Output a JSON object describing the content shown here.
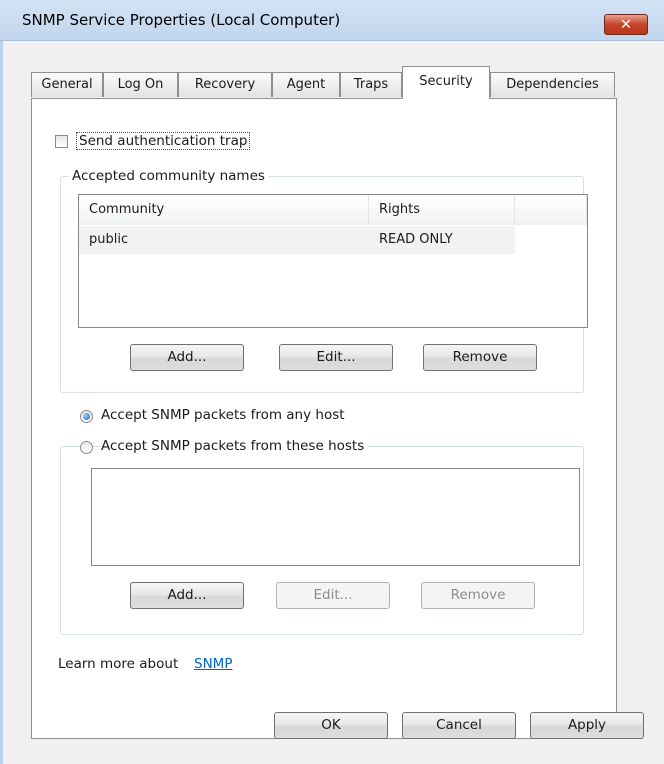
{
  "window": {
    "title": "SNMP Service Properties (Local Computer)",
    "close_label": "✕"
  },
  "tabs": [
    {
      "label": "General"
    },
    {
      "label": "Log On"
    },
    {
      "label": "Recovery"
    },
    {
      "label": "Agent"
    },
    {
      "label": "Traps"
    },
    {
      "label": "Security",
      "active": true
    },
    {
      "label": "Dependencies"
    }
  ],
  "security": {
    "send_auth_trap": {
      "label": "Send authentication trap",
      "checked": false
    },
    "community_group": {
      "legend": "Accepted community names",
      "columns": [
        "Community",
        "Rights"
      ],
      "rows": [
        {
          "community": "public",
          "rights": "READ ONLY"
        }
      ],
      "buttons": {
        "add": "Add...",
        "edit": "Edit...",
        "remove": "Remove"
      }
    },
    "accept_any_host": {
      "label": "Accept SNMP packets from any host",
      "selected": true
    },
    "accept_these_hosts": {
      "label": "Accept SNMP packets from these hosts",
      "selected": false
    },
    "hosts_buttons": {
      "add": "Add...",
      "edit": "Edit...",
      "remove": "Remove"
    },
    "learn_more": {
      "prefix": "Learn more about ",
      "link": "SNMP"
    }
  },
  "footer": {
    "ok": "OK",
    "cancel": "Cancel",
    "apply": "Apply"
  }
}
